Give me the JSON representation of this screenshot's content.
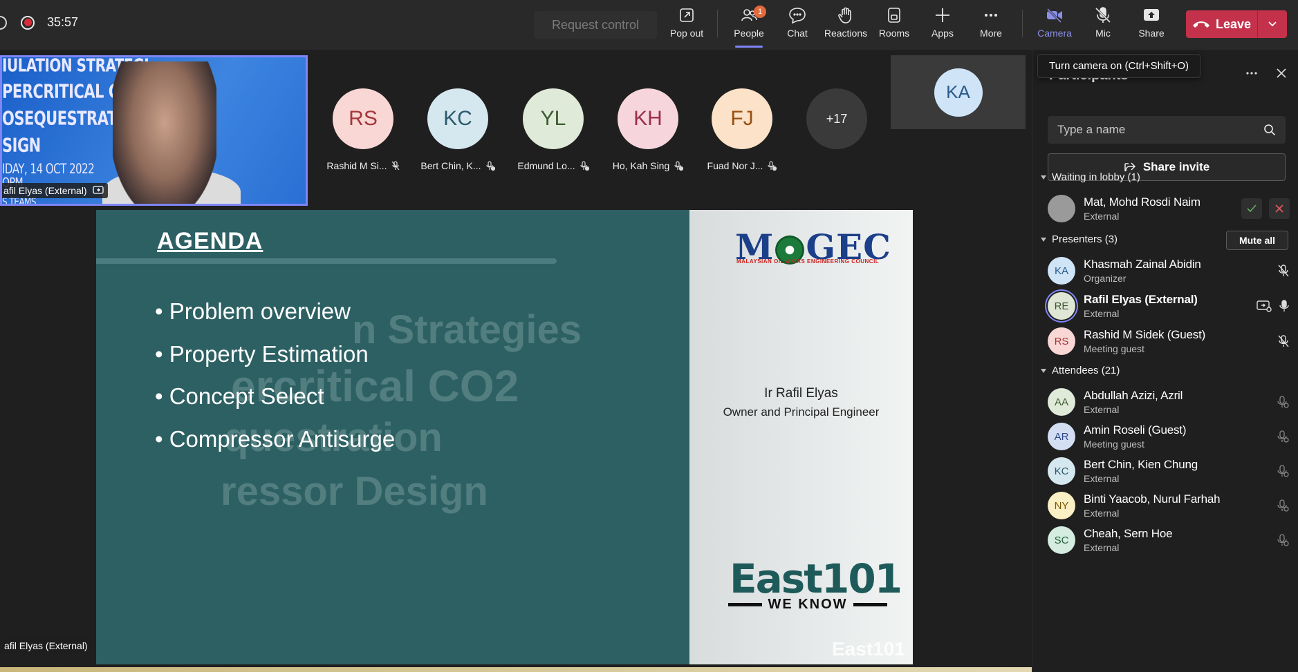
{
  "meeting": {
    "timer": "35:57",
    "request_control": "Request control"
  },
  "toolbar": {
    "popout": "Pop out",
    "people": "People",
    "people_badge": "1",
    "chat": "Chat",
    "reactions": "Reactions",
    "rooms": "Rooms",
    "apps": "Apps",
    "more": "More",
    "camera": "Camera",
    "mic": "Mic",
    "share": "Share",
    "leave": "Leave"
  },
  "tooltip": "Turn camera on (Ctrl+Shift+O)",
  "self_video": {
    "name": "afil Elyas (External)",
    "lines": [
      "IULATION STRATEGI",
      "PERCRITICAL CO2",
      "OSEQUESTRATION",
      "SIGN",
      "IDAY, 14 OCT 2022",
      "OPM",
      "S TEAMS"
    ]
  },
  "gallery": [
    {
      "initials": "RS",
      "label": "Rashid M Si...",
      "bg": "#f8d7d5",
      "fg": "#a4373a"
    },
    {
      "initials": "KC",
      "label": "Bert Chin, K...",
      "bg": "#d6e8ef",
      "fg": "#2b5a6e"
    },
    {
      "initials": "YL",
      "label": "Edmund Lo...",
      "bg": "#e0ead9",
      "fg": "#3b5a30"
    },
    {
      "initials": "KH",
      "label": "Ho, Kah Sing",
      "bg": "#f6d6dc",
      "fg": "#9c2e4a"
    },
    {
      "initials": "FJ",
      "label": "Fuad Nor J...",
      "bg": "#fbe2c8",
      "fg": "#9a4e10"
    }
  ],
  "overflow_count": "+17",
  "ka_tile": "KA",
  "slide": {
    "title": "AGENDA",
    "bullets": [
      "• Problem overview",
      "• Property Estimation",
      "• Concept Select",
      "• Compressor Antisurge"
    ],
    "ghost_lines": [
      "n Strategies",
      "ercritical CO2",
      "questration",
      "ressor Design"
    ],
    "logo_left": "M",
    "logo_right": "GEC",
    "logo_sub": "MALAYSIAN OIL & GAS ENGINEERING COUNCIL",
    "presenter_name": "Ir Rafil Elyas",
    "presenter_role": "Owner and Principal Engineer",
    "east_logo": "East101",
    "east_sub": "WE KNOW",
    "east_watermark": "East101"
  },
  "bottom_tag": "afil Elyas (External)",
  "panel": {
    "title": "Participants",
    "search_placeholder": "Type a name",
    "share_invite": "Share invite",
    "lobby_header": "Waiting in lobby (1)",
    "presenters_header": "Presenters (3)",
    "mute_all": "Mute all",
    "attendees_header": "Attendees (21)",
    "lobby": [
      {
        "name": "Mat, Mohd Rosdi Naim",
        "role": "External"
      }
    ],
    "presenters": [
      {
        "initials": "KA",
        "name": "Khasmah Zainal Abidin",
        "role": "Organizer",
        "bg": "#cfe4f7",
        "fg": "#2a5a8a"
      },
      {
        "initials": "RE",
        "name": "Rafil Elyas (External)",
        "role": "External",
        "bg": "#dfe6d5",
        "fg": "#3d5433"
      },
      {
        "initials": "RS",
        "name": "Rashid M Sidek (Guest)",
        "role": "Meeting guest",
        "bg": "#f8d7d5",
        "fg": "#a4373a"
      }
    ],
    "attendees": [
      {
        "initials": "AA",
        "name": "Abdullah Azizi, Azril",
        "role": "External",
        "bg": "#e0ead9",
        "fg": "#3b5a30"
      },
      {
        "initials": "AR",
        "name": "Amin Roseli (Guest)",
        "role": "Meeting guest",
        "bg": "#d4def3",
        "fg": "#2e4a8a"
      },
      {
        "initials": "KC",
        "name": "Bert Chin, Kien Chung",
        "role": "External",
        "bg": "#d6e8ef",
        "fg": "#2b5a6e"
      },
      {
        "initials": "NY",
        "name": "Binti Yaacob, Nurul Farhah",
        "role": "External",
        "bg": "#fbefc6",
        "fg": "#7a5a00"
      },
      {
        "initials": "SC",
        "name": "Cheah, Sern Hoe",
        "role": "External",
        "bg": "#d5ece0",
        "fg": "#23603f"
      }
    ]
  }
}
